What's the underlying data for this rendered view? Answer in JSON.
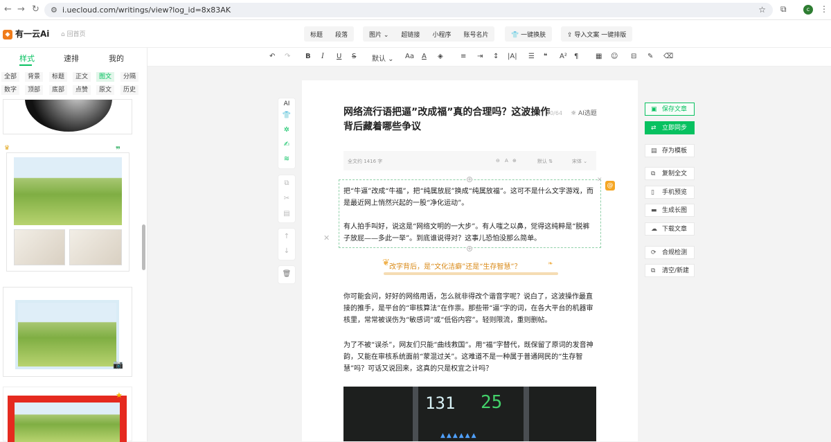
{
  "browser": {
    "url": "i.uecloud.com/writings/view?log_id=8x83AK",
    "profile_initial": "c"
  },
  "header": {
    "logo": "有一云Ai",
    "home": "回首页",
    "group1": [
      "标题",
      "段落"
    ],
    "group2": [
      "图片",
      "超链接",
      "小程序",
      "账号名片"
    ],
    "skin_button": "一键换肤",
    "import_button": "导入文案 一键排版"
  },
  "left_panel": {
    "tabs": [
      "样式",
      "速排",
      "我的"
    ],
    "categories_row1": [
      "全部",
      "背景",
      "标题",
      "正文",
      "图文",
      "分隔"
    ],
    "categories_row2": [
      "数字",
      "顶部",
      "底部",
      "点赞",
      "原文",
      "历史"
    ]
  },
  "toolbar": {
    "font_size": "默认"
  },
  "rail": {
    "ai_label": "AI"
  },
  "doc": {
    "title": "网络流行语把逼”改成福”真的合理吗？这波操作背后藏着哪些争议",
    "title_count": "30/64",
    "ai_title": "AI选题",
    "word_count": "全文约 1416 字",
    "info_a": "A",
    "info_default": "默认",
    "info_font": "宋体",
    "para1": "把“牛逼”改成“牛福”，把“纯属放屁”换成“纯属放福”。这可不是什么文字游戏，而是最近网上悄然兴起的一股“净化运动”。",
    "para2": "有人拍手叫好，说这是“网络文明的一大步”。有人嗤之以鼻，觉得这纯粹是“脱裤子放屁——多此一举”。到底谁说得对？这事儿恐怕没那么简单。",
    "section": "改字背后，是“文化洁癖”还是“生存智慧”？",
    "para3": "你可能会问，好好的网络用语，怎么就非得改个谐音字呢？说白了，这波操作最直接的推手，是平台的“审核算法”在作祟。那些带“逼”字的词，在各大平台的机器审核里，常常被误伤为“敏感词”或“低俗内容”。轻则限流，重则删帖。",
    "para4": "为了不被“误杀”，网友们只能“曲线救国”。用“福”字替代，既保留了原词的发音神韵，又能在审核系统面前“蒙混过关”。这难道不是一种属于普通网民的“生存智慧”吗？可话又说回来，这真的只是权宜之计吗？",
    "photo_n1": "131",
    "photo_n2": "25"
  },
  "actions": [
    "保存文章",
    "立即同步",
    "存为模板",
    "复制全文",
    "手机预览",
    "生成长图",
    "下载文章",
    "合规检测",
    "清空/新建"
  ],
  "colors": {
    "accent": "#07c160",
    "section": "#d98a18"
  }
}
